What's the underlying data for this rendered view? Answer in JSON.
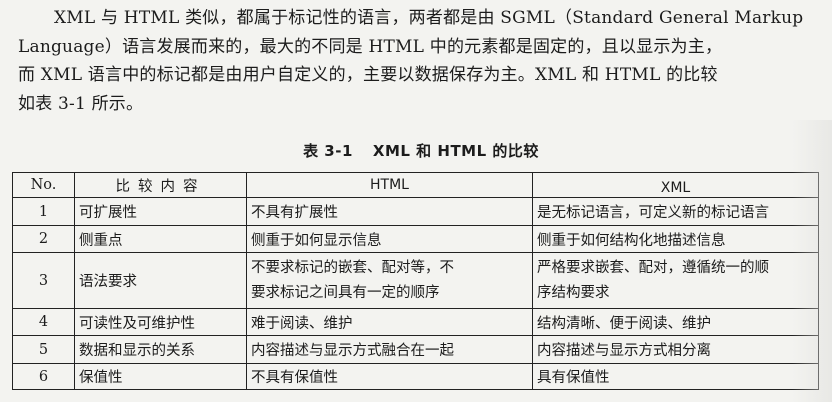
{
  "paragraph": {
    "lines": [
      "XML 与 HTML 类似，都属于标记性的语言，两者都是由 SGML（Standard General Markup",
      "Language）语言发展而来的，最大的不同是 HTML 中的元素都是固定的，且以显示为主，",
      "而 XML 语言中的标记都是由用户自定义的，主要以数据保存为主。XML 和 HTML 的比较",
      "如表 3-1 所示。"
    ]
  },
  "table_caption": {
    "number": "表 3-1",
    "title": "XML 和 HTML 的比较"
  },
  "table": {
    "headers": {
      "no": "No.",
      "content": "比较内容",
      "html": "HTML",
      "xml": "XML"
    },
    "rows": [
      {
        "no": "1",
        "content": "可扩展性",
        "html": [
          "不具有扩展性"
        ],
        "xml": [
          "是无标记语言，可定义新的标记语言"
        ]
      },
      {
        "no": "2",
        "content": "侧重点",
        "html": [
          "侧重于如何显示信息"
        ],
        "xml": [
          "侧重于如何结构化地描述信息"
        ]
      },
      {
        "no": "3",
        "content": "语法要求",
        "html": [
          "不要求标记的嵌套、配对等，不",
          "要求标记之间具有一定的顺序"
        ],
        "xml": [
          "严格要求嵌套、配对，遵循统一的顺",
          "序结构要求"
        ]
      },
      {
        "no": "4",
        "content": "可读性及可维护性",
        "html": [
          "难于阅读、维护"
        ],
        "xml": [
          "结构清晰、便于阅读、维护"
        ]
      },
      {
        "no": "5",
        "content": "数据和显示的关系",
        "html": [
          "内容描述与显示方式融合在一起"
        ],
        "xml": [
          "内容描述与显示方式相分离"
        ]
      },
      {
        "no": "6",
        "content": "保值性",
        "html": [
          "不具有保值性"
        ],
        "xml": [
          "具有保值性"
        ]
      }
    ]
  }
}
